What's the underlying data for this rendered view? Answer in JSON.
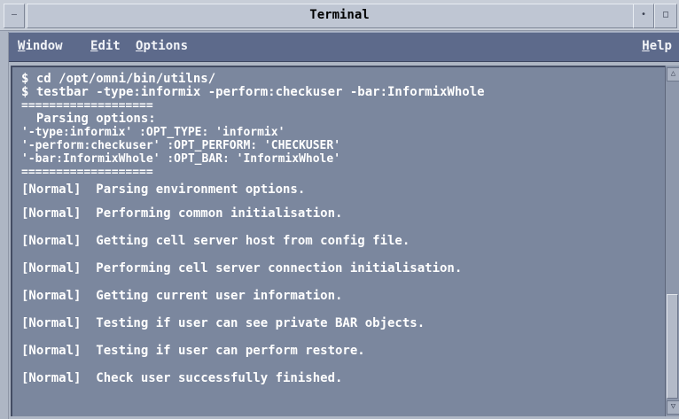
{
  "window": {
    "title": "Terminal",
    "menu_glyph": "—",
    "min_glyph": "•",
    "max_glyph": "□"
  },
  "menubar": {
    "window": {
      "mnemonic": "W",
      "rest": "indow"
    },
    "edit": {
      "mnemonic": "E",
      "rest": "dit"
    },
    "options": {
      "mnemonic": "O",
      "rest": "ptions"
    },
    "help": {
      "mnemonic": "H",
      "rest": "elp"
    }
  },
  "terminal": {
    "header_lines": [
      "$ cd /opt/omni/bin/utilns/",
      "$ testbar -type:informix -perform:checkuser -bar:InformixWhole",
      "===================",
      "  Parsing options:",
      "'-type:informix' :OPT_TYPE: 'informix'",
      "'-perform:checkuser' :OPT_PERFORM: 'CHECKUSER'",
      "'-bar:InformixWhole' :OPT_BAR: 'InformixWhole'",
      "==================="
    ],
    "messages": [
      "[Normal]  Parsing environment options.",
      "[Normal]  Performing common initialisation.",
      "[Normal]  Getting cell server host from config file.",
      "[Normal]  Performing cell server connection initialisation.",
      "[Normal]  Getting current user information.",
      "[Normal]  Testing if user can see private BAR objects.",
      "[Normal]  Testing if user can perform restore.",
      "[Normal]  Check user successfully finished."
    ]
  },
  "scrollbar": {
    "up_glyph": "△",
    "down_glyph": "▽"
  }
}
